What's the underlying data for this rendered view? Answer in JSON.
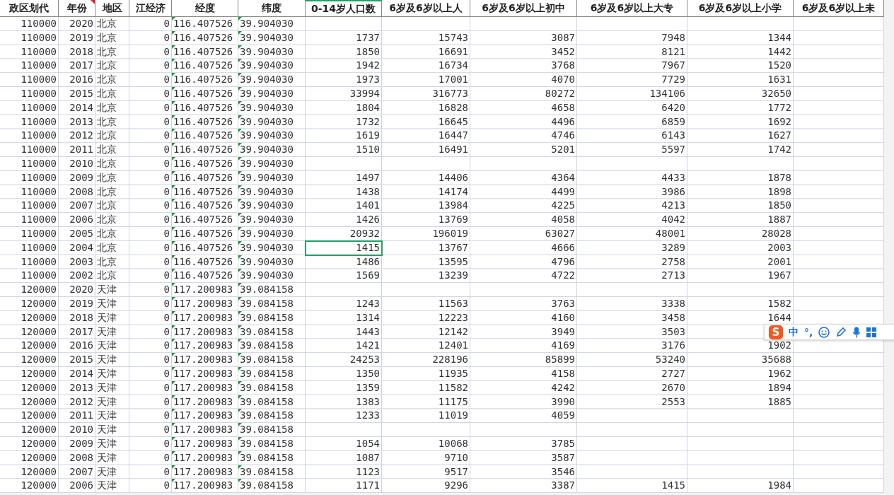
{
  "table": {
    "columns": [
      {
        "label": "政区划代",
        "kind": "number",
        "comment": false,
        "selected": false
      },
      {
        "label": "年份",
        "kind": "number",
        "comment": true,
        "selected": false
      },
      {
        "label": "地区",
        "kind": "text",
        "comment": false,
        "selected": false
      },
      {
        "label": "江经济",
        "kind": "number",
        "comment": false,
        "selected": false
      },
      {
        "label": "经度",
        "kind": "text_number",
        "comment": false,
        "selected": false
      },
      {
        "label": "纬度",
        "kind": "text_number",
        "comment": false,
        "selected": false
      },
      {
        "label": "0-14岁人口数",
        "kind": "number",
        "comment": false,
        "selected": true
      },
      {
        "label": "6岁及6岁以上人",
        "kind": "number",
        "comment": false,
        "selected": false
      },
      {
        "label": "6岁及6岁以上初中",
        "kind": "number",
        "comment": false,
        "selected": false
      },
      {
        "label": "6岁及6岁以上大专",
        "kind": "number",
        "comment": false,
        "selected": false
      },
      {
        "label": "6岁及6岁以上小学",
        "kind": "number",
        "comment": false,
        "selected": false
      },
      {
        "label": "6岁及6岁以上未",
        "kind": "number",
        "comment": false,
        "selected": false
      }
    ],
    "rows": [
      {
        "selected": false,
        "cells": [
          "110000",
          "2020",
          "北京",
          "0",
          "116.407526",
          "39.904030",
          "",
          "",
          "",
          "",
          ""
        ]
      },
      {
        "selected": false,
        "cells": [
          "110000",
          "2019",
          "北京",
          "0",
          "116.407526",
          "39.904030",
          "1737",
          "15743",
          "3087",
          "7948",
          "1344"
        ]
      },
      {
        "selected": false,
        "cells": [
          "110000",
          "2018",
          "北京",
          "0",
          "116.407526",
          "39.904030",
          "1850",
          "16691",
          "3452",
          "8121",
          "1442"
        ]
      },
      {
        "selected": false,
        "cells": [
          "110000",
          "2017",
          "北京",
          "0",
          "116.407526",
          "39.904030",
          "1942",
          "16734",
          "3768",
          "7967",
          "1520"
        ]
      },
      {
        "selected": false,
        "cells": [
          "110000",
          "2016",
          "北京",
          "0",
          "116.407526",
          "39.904030",
          "1973",
          "17001",
          "4070",
          "7729",
          "1631"
        ]
      },
      {
        "selected": false,
        "cells": [
          "110000",
          "2015",
          "北京",
          "0",
          "116.407526",
          "39.904030",
          "33994",
          "316773",
          "80272",
          "134106",
          "32650"
        ]
      },
      {
        "selected": false,
        "cells": [
          "110000",
          "2014",
          "北京",
          "0",
          "116.407526",
          "39.904030",
          "1804",
          "16828",
          "4658",
          "6420",
          "1772"
        ]
      },
      {
        "selected": false,
        "cells": [
          "110000",
          "2013",
          "北京",
          "0",
          "116.407526",
          "39.904030",
          "1732",
          "16645",
          "4496",
          "6859",
          "1692"
        ]
      },
      {
        "selected": false,
        "cells": [
          "110000",
          "2012",
          "北京",
          "0",
          "116.407526",
          "39.904030",
          "1619",
          "16447",
          "4746",
          "6143",
          "1627"
        ]
      },
      {
        "selected": false,
        "cells": [
          "110000",
          "2011",
          "北京",
          "0",
          "116.407526",
          "39.904030",
          "1510",
          "16491",
          "5201",
          "5597",
          "1742"
        ]
      },
      {
        "selected": false,
        "cells": [
          "110000",
          "2010",
          "北京",
          "0",
          "116.407526",
          "39.904030",
          "",
          "",
          "",
          "",
          ""
        ]
      },
      {
        "selected": false,
        "cells": [
          "110000",
          "2009",
          "北京",
          "0",
          "116.407526",
          "39.904030",
          "1497",
          "14406",
          "4364",
          "4433",
          "1878"
        ]
      },
      {
        "selected": false,
        "cells": [
          "110000",
          "2008",
          "北京",
          "0",
          "116.407526",
          "39.904030",
          "1438",
          "14174",
          "4499",
          "3986",
          "1898"
        ]
      },
      {
        "selected": false,
        "cells": [
          "110000",
          "2007",
          "北京",
          "0",
          "116.407526",
          "39.904030",
          "1401",
          "13984",
          "4225",
          "4213",
          "1850"
        ]
      },
      {
        "selected": false,
        "cells": [
          "110000",
          "2006",
          "北京",
          "0",
          "116.407526",
          "39.904030",
          "1426",
          "13769",
          "4058",
          "4042",
          "1887"
        ]
      },
      {
        "selected": false,
        "cells": [
          "110000",
          "2005",
          "北京",
          "0",
          "116.407526",
          "39.904030",
          "20932",
          "196019",
          "63027",
          "48001",
          "28028"
        ]
      },
      {
        "selected": true,
        "cells": [
          "110000",
          "2004",
          "北京",
          "0",
          "116.407526",
          "39.904030",
          "1415",
          "13767",
          "4666",
          "3289",
          "2003"
        ]
      },
      {
        "selected": false,
        "cells": [
          "110000",
          "2003",
          "北京",
          "0",
          "116.407526",
          "39.904030",
          "1486",
          "13595",
          "4796",
          "2758",
          "2001"
        ]
      },
      {
        "selected": false,
        "cells": [
          "110000",
          "2002",
          "北京",
          "0",
          "116.407526",
          "39.904030",
          "1569",
          "13239",
          "4722",
          "2713",
          "1967"
        ]
      },
      {
        "selected": false,
        "cells": [
          "120000",
          "2020",
          "天津",
          "0",
          "117.200983",
          "39.084158",
          "",
          "",
          "",
          "",
          ""
        ]
      },
      {
        "selected": false,
        "cells": [
          "120000",
          "2019",
          "天津",
          "0",
          "117.200983",
          "39.084158",
          "1243",
          "11563",
          "3763",
          "3338",
          "1582"
        ]
      },
      {
        "selected": false,
        "cells": [
          "120000",
          "2018",
          "天津",
          "0",
          "117.200983",
          "39.084158",
          "1314",
          "12223",
          "4160",
          "3458",
          "1644"
        ]
      },
      {
        "selected": false,
        "cells": [
          "120000",
          "2017",
          "天津",
          "0",
          "117.200983",
          "39.084158",
          "1443",
          "12142",
          "3949",
          "3503",
          ""
        ]
      },
      {
        "selected": false,
        "cells": [
          "120000",
          "2016",
          "天津",
          "0",
          "117.200983",
          "39.084158",
          "1421",
          "12401",
          "4169",
          "3176",
          "1902"
        ]
      },
      {
        "selected": false,
        "cells": [
          "120000",
          "2015",
          "天津",
          "0",
          "117.200983",
          "39.084158",
          "24253",
          "228196",
          "85899",
          "53240",
          "35688"
        ]
      },
      {
        "selected": false,
        "cells": [
          "120000",
          "2014",
          "天津",
          "0",
          "117.200983",
          "39.084158",
          "1350",
          "11935",
          "4158",
          "2727",
          "1962"
        ]
      },
      {
        "selected": false,
        "cells": [
          "120000",
          "2013",
          "天津",
          "0",
          "117.200983",
          "39.084158",
          "1359",
          "11582",
          "4242",
          "2670",
          "1894"
        ]
      },
      {
        "selected": false,
        "cells": [
          "120000",
          "2012",
          "天津",
          "0",
          "117.200983",
          "39.084158",
          "1383",
          "11175",
          "3990",
          "2553",
          "1885"
        ]
      },
      {
        "selected": false,
        "cells": [
          "120000",
          "2011",
          "天津",
          "0",
          "117.200983",
          "39.084158",
          "1233",
          "11019",
          "4059",
          "",
          ""
        ]
      },
      {
        "selected": false,
        "cells": [
          "120000",
          "2010",
          "天津",
          "0",
          "117.200983",
          "39.084158",
          "",
          "",
          "",
          "",
          ""
        ]
      },
      {
        "selected": false,
        "cells": [
          "120000",
          "2009",
          "天津",
          "0",
          "117.200983",
          "39.084158",
          "1054",
          "10068",
          "3785",
          "",
          ""
        ]
      },
      {
        "selected": false,
        "cells": [
          "120000",
          "2008",
          "天津",
          "0",
          "117.200983",
          "39.084158",
          "1087",
          "9710",
          "3587",
          "",
          ""
        ]
      },
      {
        "selected": false,
        "cells": [
          "120000",
          "2007",
          "天津",
          "0",
          "117.200983",
          "39.084158",
          "1123",
          "9517",
          "3546",
          "",
          ""
        ]
      },
      {
        "selected": false,
        "cells": [
          "120000",
          "2006",
          "天津",
          "0",
          "117.200983",
          "39.084158",
          "1171",
          "9296",
          "3387",
          "1415",
          "1984"
        ]
      }
    ]
  },
  "ime_toolbar": {
    "logo": "S",
    "mode": "中",
    "punctuation": "°,"
  }
}
